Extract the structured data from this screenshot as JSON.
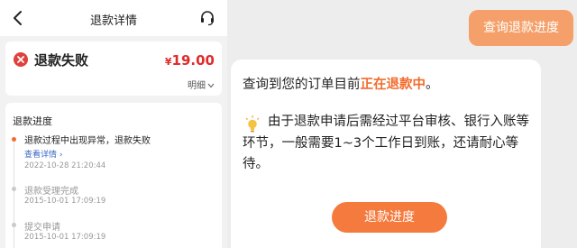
{
  "header": {
    "title": "退款详情",
    "back_icon": "chevron-left-icon",
    "support_icon": "headset-icon"
  },
  "status": {
    "icon": "close-circle-icon",
    "text": "退款失败",
    "amount": "19.00",
    "currency": "¥",
    "detail_label": "明细",
    "fail_color": "#e0413a"
  },
  "progress": {
    "title": "退款进度",
    "steps": [
      {
        "text": "退款过程中出现异常，退款失败",
        "link": "查看详情 ›",
        "time": "2022-10-28 21:20:44",
        "active": true
      },
      {
        "text": "退款受理完成",
        "time": "2015-10-01 17:09:19",
        "active": false
      },
      {
        "text": "提交申请",
        "time": "2015-10-01 17:09:19",
        "active": false
      }
    ]
  },
  "chat": {
    "query_button": "查询退款进度",
    "message": {
      "prefix": "查询到您的订单目前",
      "highlight": "正在退款中",
      "suffix": "。",
      "body": "由于退款申请后需经过平台审核、银行入账等环节，一般需要1~3个工作日到账，还请耐心等待。",
      "bulb_icon": "lightbulb-icon"
    },
    "refund_button": "退款进度"
  },
  "colors": {
    "accent": "#f26b2c",
    "price": "#e02b2b",
    "link": "#3a67c5",
    "bubble": "#f5a06a"
  }
}
